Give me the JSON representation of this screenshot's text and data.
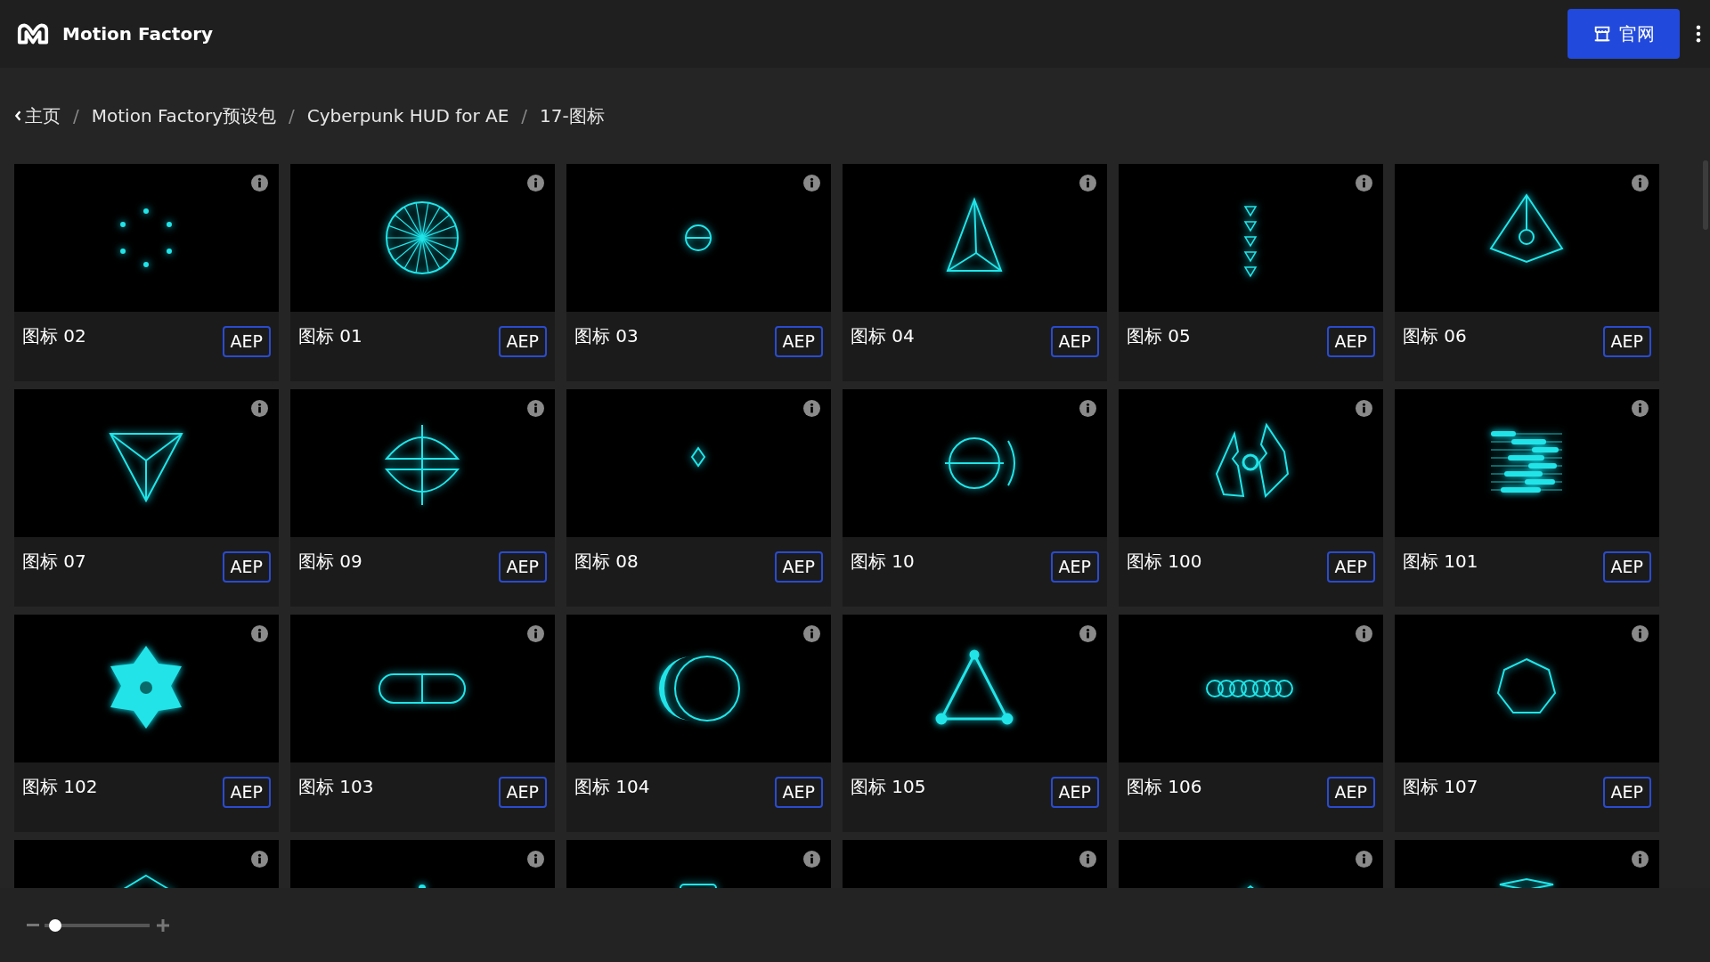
{
  "header": {
    "brand": "Motion Factory",
    "site_button": "官网"
  },
  "breadcrumb": {
    "items": [
      "主页",
      "Motion Factory预设包",
      "Cyberpunk HUD for AE",
      "17-图标"
    ],
    "separators": [
      "/",
      "/",
      "/"
    ]
  },
  "cards": [
    {
      "kind": "full",
      "title": "图标 02",
      "badge": "AEP"
    },
    {
      "kind": "full",
      "title": "图标 01",
      "badge": "AEP"
    },
    {
      "kind": "full",
      "title": "图标 03",
      "badge": "AEP"
    },
    {
      "kind": "full",
      "title": "图标 04",
      "badge": "AEP"
    },
    {
      "kind": "full",
      "title": "图标 05",
      "badge": "AEP"
    },
    {
      "kind": "full",
      "title": "图标 06",
      "badge": "AEP"
    },
    {
      "kind": "full",
      "title": "图标 07",
      "badge": "AEP"
    },
    {
      "kind": "full",
      "title": "图标 09",
      "badge": "AEP"
    },
    {
      "kind": "full",
      "title": "图标 08",
      "badge": "AEP"
    },
    {
      "kind": "full",
      "title": "图标 10",
      "badge": "AEP"
    },
    {
      "kind": "full",
      "title": "图标 100",
      "badge": "AEP"
    },
    {
      "kind": "full",
      "title": "图标 101",
      "badge": "AEP"
    },
    {
      "kind": "full",
      "title": "图标 102",
      "badge": "AEP"
    },
    {
      "kind": "full",
      "title": "图标 103",
      "badge": "AEP"
    },
    {
      "kind": "full",
      "title": "图标 104",
      "badge": "AEP"
    },
    {
      "kind": "full",
      "title": "图标 105",
      "badge": "AEP"
    },
    {
      "kind": "full",
      "title": "图标 106",
      "badge": "AEP"
    },
    {
      "kind": "full",
      "title": "图标 107",
      "badge": "AEP"
    },
    {
      "kind": "cut"
    },
    {
      "kind": "cut"
    },
    {
      "kind": "cut"
    },
    {
      "kind": "cut"
    },
    {
      "kind": "cut"
    },
    {
      "kind": "cut"
    }
  ],
  "zoom_slider": {
    "level": 0.05
  }
}
